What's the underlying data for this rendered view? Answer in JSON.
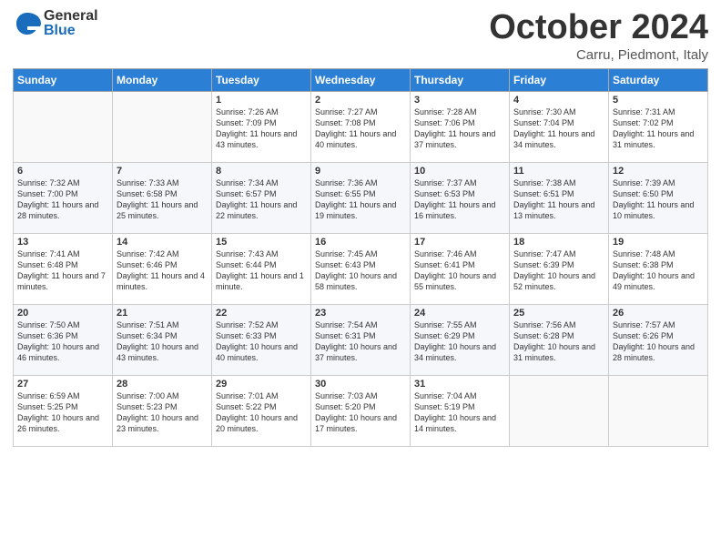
{
  "header": {
    "logo_general": "General",
    "logo_blue": "Blue",
    "title": "October 2024",
    "subtitle": "Carru, Piedmont, Italy"
  },
  "weekdays": [
    "Sunday",
    "Monday",
    "Tuesday",
    "Wednesday",
    "Thursday",
    "Friday",
    "Saturday"
  ],
  "weeks": [
    [
      {
        "day": "",
        "info": ""
      },
      {
        "day": "",
        "info": ""
      },
      {
        "day": "1",
        "info": "Sunrise: 7:26 AM\nSunset: 7:09 PM\nDaylight: 11 hours and 43 minutes."
      },
      {
        "day": "2",
        "info": "Sunrise: 7:27 AM\nSunset: 7:08 PM\nDaylight: 11 hours and 40 minutes."
      },
      {
        "day": "3",
        "info": "Sunrise: 7:28 AM\nSunset: 7:06 PM\nDaylight: 11 hours and 37 minutes."
      },
      {
        "day": "4",
        "info": "Sunrise: 7:30 AM\nSunset: 7:04 PM\nDaylight: 11 hours and 34 minutes."
      },
      {
        "day": "5",
        "info": "Sunrise: 7:31 AM\nSunset: 7:02 PM\nDaylight: 11 hours and 31 minutes."
      }
    ],
    [
      {
        "day": "6",
        "info": "Sunrise: 7:32 AM\nSunset: 7:00 PM\nDaylight: 11 hours and 28 minutes."
      },
      {
        "day": "7",
        "info": "Sunrise: 7:33 AM\nSunset: 6:58 PM\nDaylight: 11 hours and 25 minutes."
      },
      {
        "day": "8",
        "info": "Sunrise: 7:34 AM\nSunset: 6:57 PM\nDaylight: 11 hours and 22 minutes."
      },
      {
        "day": "9",
        "info": "Sunrise: 7:36 AM\nSunset: 6:55 PM\nDaylight: 11 hours and 19 minutes."
      },
      {
        "day": "10",
        "info": "Sunrise: 7:37 AM\nSunset: 6:53 PM\nDaylight: 11 hours and 16 minutes."
      },
      {
        "day": "11",
        "info": "Sunrise: 7:38 AM\nSunset: 6:51 PM\nDaylight: 11 hours and 13 minutes."
      },
      {
        "day": "12",
        "info": "Sunrise: 7:39 AM\nSunset: 6:50 PM\nDaylight: 11 hours and 10 minutes."
      }
    ],
    [
      {
        "day": "13",
        "info": "Sunrise: 7:41 AM\nSunset: 6:48 PM\nDaylight: 11 hours and 7 minutes."
      },
      {
        "day": "14",
        "info": "Sunrise: 7:42 AM\nSunset: 6:46 PM\nDaylight: 11 hours and 4 minutes."
      },
      {
        "day": "15",
        "info": "Sunrise: 7:43 AM\nSunset: 6:44 PM\nDaylight: 11 hours and 1 minute."
      },
      {
        "day": "16",
        "info": "Sunrise: 7:45 AM\nSunset: 6:43 PM\nDaylight: 10 hours and 58 minutes."
      },
      {
        "day": "17",
        "info": "Sunrise: 7:46 AM\nSunset: 6:41 PM\nDaylight: 10 hours and 55 minutes."
      },
      {
        "day": "18",
        "info": "Sunrise: 7:47 AM\nSunset: 6:39 PM\nDaylight: 10 hours and 52 minutes."
      },
      {
        "day": "19",
        "info": "Sunrise: 7:48 AM\nSunset: 6:38 PM\nDaylight: 10 hours and 49 minutes."
      }
    ],
    [
      {
        "day": "20",
        "info": "Sunrise: 7:50 AM\nSunset: 6:36 PM\nDaylight: 10 hours and 46 minutes."
      },
      {
        "day": "21",
        "info": "Sunrise: 7:51 AM\nSunset: 6:34 PM\nDaylight: 10 hours and 43 minutes."
      },
      {
        "day": "22",
        "info": "Sunrise: 7:52 AM\nSunset: 6:33 PM\nDaylight: 10 hours and 40 minutes."
      },
      {
        "day": "23",
        "info": "Sunrise: 7:54 AM\nSunset: 6:31 PM\nDaylight: 10 hours and 37 minutes."
      },
      {
        "day": "24",
        "info": "Sunrise: 7:55 AM\nSunset: 6:29 PM\nDaylight: 10 hours and 34 minutes."
      },
      {
        "day": "25",
        "info": "Sunrise: 7:56 AM\nSunset: 6:28 PM\nDaylight: 10 hours and 31 minutes."
      },
      {
        "day": "26",
        "info": "Sunrise: 7:57 AM\nSunset: 6:26 PM\nDaylight: 10 hours and 28 minutes."
      }
    ],
    [
      {
        "day": "27",
        "info": "Sunrise: 6:59 AM\nSunset: 5:25 PM\nDaylight: 10 hours and 26 minutes."
      },
      {
        "day": "28",
        "info": "Sunrise: 7:00 AM\nSunset: 5:23 PM\nDaylight: 10 hours and 23 minutes."
      },
      {
        "day": "29",
        "info": "Sunrise: 7:01 AM\nSunset: 5:22 PM\nDaylight: 10 hours and 20 minutes."
      },
      {
        "day": "30",
        "info": "Sunrise: 7:03 AM\nSunset: 5:20 PM\nDaylight: 10 hours and 17 minutes."
      },
      {
        "day": "31",
        "info": "Sunrise: 7:04 AM\nSunset: 5:19 PM\nDaylight: 10 hours and 14 minutes."
      },
      {
        "day": "",
        "info": ""
      },
      {
        "day": "",
        "info": ""
      }
    ]
  ]
}
